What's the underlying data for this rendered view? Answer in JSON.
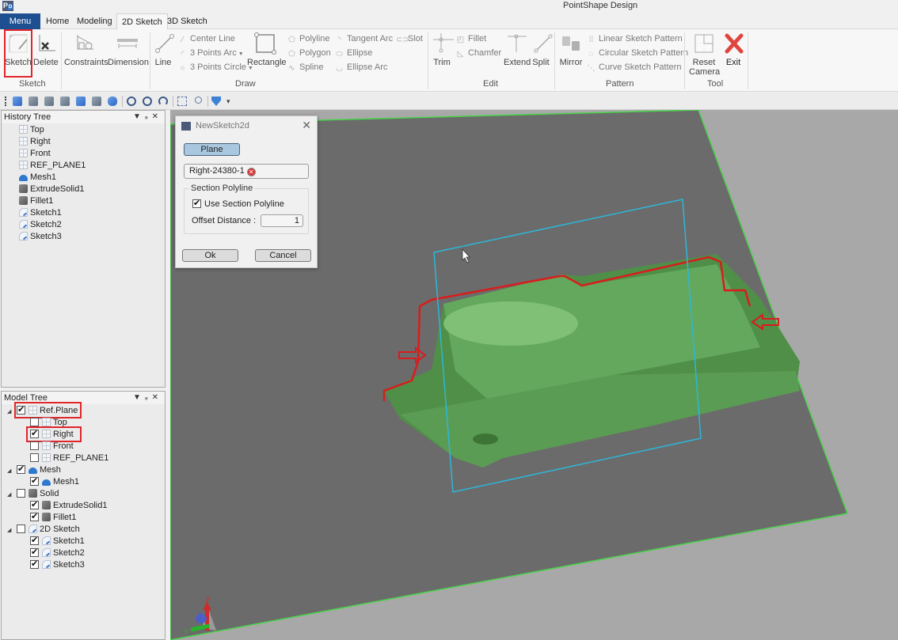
{
  "app": {
    "title": "PointShape Design",
    "logo": "P"
  },
  "ribbon_tabs": [
    {
      "label": "Menu"
    },
    {
      "label": "Home"
    },
    {
      "label": "Modeling"
    },
    {
      "label": "2D Sketch",
      "active": true
    },
    {
      "label": "3D Sketch"
    }
  ],
  "ribbon": {
    "groups": {
      "sketch": "Sketch",
      "draw": "Draw",
      "edit": "Edit",
      "pattern": "Pattern",
      "tool": "Tool"
    },
    "sketch_btn": "Sketch",
    "delete_btn": "Delete",
    "constraints_btn": "Constraints",
    "dimension_btn": "Dimension",
    "line_btn": "Line",
    "center_line": "Center Line",
    "three_points_arc": "3 Points Arc",
    "three_points_circle": "3 Points Circle",
    "rectangle_btn": "Rectangle",
    "polyline": "Polyline",
    "polygon": "Polygon",
    "spline": "Spline",
    "tangent_arc": "Tangent Arc",
    "ellipse": "Ellipse",
    "ellipse_arc": "Ellipse Arc",
    "slot": "Slot",
    "trim_btn": "Trim",
    "fillet": "Fillet",
    "chamfer": "Chamfer",
    "extend_btn": "Extend",
    "split_btn": "Split",
    "mirror_btn": "Mirror",
    "linear_pattern": "Linear Sketch Pattern",
    "circular_pattern": "Circular Sketch Pattern",
    "curve_pattern": "Curve Sketch Pattern",
    "reset_camera_line1": "Reset",
    "reset_camera_line2": "Camera",
    "exit_btn": "Exit"
  },
  "history_tree": {
    "title": "History Tree",
    "items": [
      {
        "label": "Top",
        "icon": "plane-icon"
      },
      {
        "label": "Right",
        "icon": "plane-icon"
      },
      {
        "label": "Front",
        "icon": "plane-icon"
      },
      {
        "label": "REF_PLANE1",
        "icon": "plane-icon"
      },
      {
        "label": "Mesh1",
        "icon": "mesh-icon"
      },
      {
        "label": "ExtrudeSolid1",
        "icon": "solid-icon"
      },
      {
        "label": "Fillet1",
        "icon": "solid-icon"
      },
      {
        "label": "Sketch1",
        "icon": "sketch-icon"
      },
      {
        "label": "Sketch2",
        "icon": "sketch-icon"
      },
      {
        "label": "Sketch3",
        "icon": "sketch-icon"
      }
    ]
  },
  "model_tree": {
    "title": "Model Tree",
    "groups": [
      {
        "label": "Ref.Plane",
        "checked": true,
        "icon": "plane-icon",
        "children": [
          {
            "label": "Top",
            "checked": false
          },
          {
            "label": "Right",
            "checked": true
          },
          {
            "label": "Front",
            "checked": false
          },
          {
            "label": "REF_PLANE1",
            "checked": false
          }
        ]
      },
      {
        "label": "Mesh",
        "checked": true,
        "icon": "mesh-icon",
        "children": [
          {
            "label": "Mesh1",
            "checked": true
          }
        ]
      },
      {
        "label": "Solid",
        "checked": false,
        "icon": "solid-icon",
        "children": [
          {
            "label": "ExtrudeSolid1",
            "checked": true
          },
          {
            "label": "Fillet1",
            "checked": true
          }
        ]
      },
      {
        "label": "2D Sketch",
        "checked": false,
        "icon": "sketch-icon",
        "children": [
          {
            "label": "Sketch1",
            "checked": true
          },
          {
            "label": "Sketch2",
            "checked": true
          },
          {
            "label": "Sketch3",
            "checked": true
          }
        ]
      }
    ]
  },
  "dialog": {
    "title": "NewSketch2d",
    "plane_button": "Plane",
    "plane_value": "Right-24380-1",
    "section_title": "Section Polyline",
    "use_section_label": "Use Section Polyline",
    "use_section_checked": true,
    "offset_label": "Offset Distance :",
    "offset_value": "1",
    "ok": "Ok",
    "cancel": "Cancel"
  },
  "axis_triad": {
    "z": "Z",
    "x": "X",
    "y": "Y"
  },
  "colors": {
    "accent_menu": "#1e4f91",
    "highlight": "#e0252b",
    "mesh": "#5fa35a",
    "plane_edge": "#4ad34a",
    "sketch_plane": "#2db7d9",
    "section_line": "#d91c1c"
  }
}
